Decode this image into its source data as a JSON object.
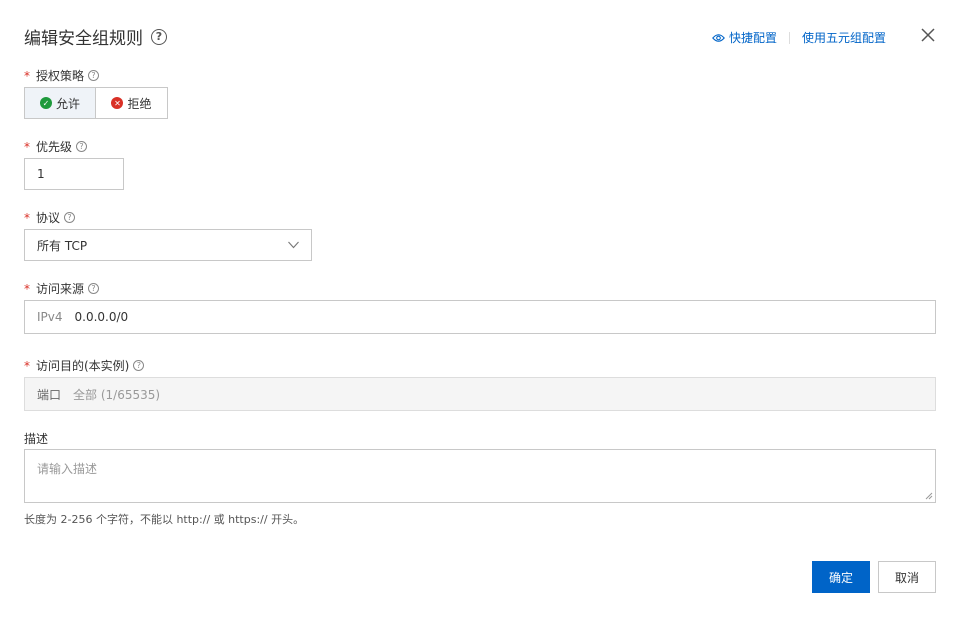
{
  "dialog": {
    "title": "编辑安全组规则",
    "quick_config": "快捷配置",
    "five_tuple_config": "使用五元组配置"
  },
  "policy": {
    "label": "授权策略",
    "allow": "允许",
    "deny": "拒绝",
    "selected": "允许"
  },
  "priority": {
    "label": "优先级",
    "value": "1"
  },
  "protocol": {
    "label": "协议",
    "value": "所有 TCP"
  },
  "source": {
    "label": "访问来源",
    "prefix": "IPv4",
    "value": "0.0.0.0/0"
  },
  "destination": {
    "label": "访问目的(本实例)",
    "prefix": "端口",
    "value": "全部 (1/65535)"
  },
  "description": {
    "label": "描述",
    "placeholder": "请输入描述",
    "hint": "长度为 2-256 个字符，不能以 http:// 或 https:// 开头。"
  },
  "buttons": {
    "confirm": "确定",
    "cancel": "取消"
  },
  "colors": {
    "primary": "#0064c8",
    "required": "#d93026",
    "allow": "#1e9a3c",
    "deny": "#d93026"
  }
}
